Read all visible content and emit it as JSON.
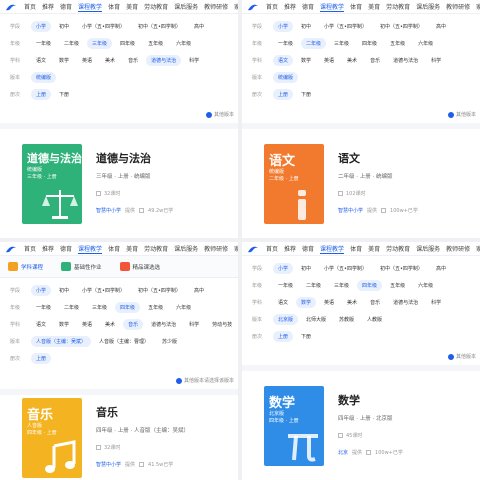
{
  "colors": {
    "accent": "#1e5ee8",
    "cover_green": "#2fb27a",
    "cover_orange": "#f27a2e",
    "cover_yellow": "#f4b320",
    "cover_blue": "#2f8de8"
  },
  "tl": {
    "nav": [
      "首页",
      "推荐",
      "德育",
      "课程教学",
      "体育",
      "美育",
      "劳动教育",
      "课后服务",
      "教师研修",
      "家"
    ],
    "nav_active": 3,
    "rows": [
      {
        "label": "学段",
        "opts": [
          "小学",
          "初中",
          "小学（五•四学制）",
          "初中（五•四学制）",
          "高中"
        ],
        "sel": 0
      },
      {
        "label": "年级",
        "opts": [
          "一年级",
          "二年级",
          "三年级",
          "四年级",
          "五年级",
          "六年级"
        ],
        "sel": 2
      },
      {
        "label": "学科",
        "opts": [
          "语文",
          "数学",
          "英语",
          "美术",
          "音乐",
          "道德与法治",
          "科学"
        ],
        "sel": 5
      },
      {
        "label": "版本",
        "opts": [
          "统编版"
        ],
        "sel": 0
      },
      {
        "label": "册次",
        "opts": [
          "上册",
          "下册"
        ],
        "sel": 0
      }
    ],
    "dict": "其他版本",
    "card": {
      "cover_title": "道德与法治",
      "cover_sub1": "统编版",
      "cover_sub2": "三年级 · 上册",
      "title": "道德与法治",
      "sub": "三年级 · 上册 · 统编版",
      "hours": "32课时",
      "provider": "智慧中小学",
      "provider_suffix": "提供",
      "views": "49.2w已学"
    }
  },
  "tr": {
    "nav": [
      "首页",
      "推荐",
      "德育",
      "课程教学",
      "体育",
      "美育",
      "劳动教育",
      "课后服务",
      "教师研修",
      "家"
    ],
    "nav_active": 3,
    "rows": [
      {
        "label": "学段",
        "opts": [
          "小学",
          "初中",
          "小学（五•四学制）",
          "初中（五•四学制）",
          "高中"
        ],
        "sel": 0
      },
      {
        "label": "年级",
        "opts": [
          "一年级",
          "二年级",
          "三年级",
          "四年级",
          "五年级",
          "六年级"
        ],
        "sel": 1
      },
      {
        "label": "学科",
        "opts": [
          "语文",
          "数学",
          "英语",
          "美术",
          "音乐",
          "道德与法治",
          "科学"
        ],
        "sel": 0
      },
      {
        "label": "版本",
        "opts": [
          "统编版"
        ],
        "sel": 0
      },
      {
        "label": "册次",
        "opts": [
          "上册",
          "下册"
        ],
        "sel": 0
      }
    ],
    "dict": "其他版本",
    "card": {
      "cover_title": "语文",
      "cover_sub1": "统编版",
      "cover_sub2": "二年级 · 上册",
      "title": "语文",
      "sub": "二年级 · 上册 · 统编版",
      "hours": "102课时",
      "provider": "智慧中小学",
      "provider_suffix": "提供",
      "views": "100w+已学"
    }
  },
  "bl": {
    "nav": [
      "首页",
      "推荐",
      "德育",
      "课程教学",
      "体育",
      "美育",
      "劳动教育",
      "课后服务",
      "教师研修",
      "家庭教育",
      "教"
    ],
    "nav_active": 3,
    "tabs": [
      "学科课程",
      "基础性作业",
      "精品课选选"
    ],
    "rows": [
      {
        "label": "学段",
        "opts": [
          "小学",
          "初中",
          "小学（五•四学制）",
          "初中（五•四学制）",
          "高中"
        ],
        "sel": 0
      },
      {
        "label": "年级",
        "opts": [
          "一年级",
          "二年级",
          "三年级",
          "四年级",
          "五年级",
          "六年级"
        ],
        "sel": 3
      },
      {
        "label": "学科",
        "opts": [
          "语文",
          "数学",
          "英语",
          "美术",
          "音乐",
          "道德与法治",
          "科学",
          "劳动与技术"
        ],
        "sel": 4
      },
      {
        "label": "版本",
        "opts": [
          "人音版（主编：吴斌）",
          "人音版（主编：曹理）",
          "苏少版"
        ],
        "sel": 0
      },
      {
        "label": "册次",
        "opts": [
          "上册"
        ],
        "sel": 0
      }
    ],
    "dict": "其他版本请选择该版本",
    "card": {
      "cover_title": "音乐",
      "cover_sub1": "人音版",
      "cover_sub2": "四年级 · 上册",
      "title": "音乐",
      "sub": "四年级 · 上册 · 人音版（主编：吴斌）",
      "hours": "32课时",
      "provider": "智慧中小学",
      "provider_suffix": "提供",
      "views": "41.5w已学"
    }
  },
  "br": {
    "nav": [
      "首页",
      "推荐",
      "德育",
      "课程教学",
      "体育",
      "美育",
      "劳动教育",
      "课后服务",
      "教师研修",
      "家"
    ],
    "nav_active": 3,
    "rows": [
      {
        "label": "学段",
        "opts": [
          "小学",
          "初中",
          "小学（五•四学制）",
          "初中（五•四学制）",
          "高中"
        ],
        "sel": 0
      },
      {
        "label": "年级",
        "opts": [
          "一年级",
          "二年级",
          "三年级",
          "四年级",
          "五年级",
          "六年级"
        ],
        "sel": 3
      },
      {
        "label": "学科",
        "opts": [
          "语文",
          "数学",
          "英语",
          "美术",
          "音乐",
          "道德与法治",
          "科学"
        ],
        "sel": 1
      },
      {
        "label": "版本",
        "opts": [
          "北京版",
          "北师大版",
          "苏教版",
          "人教版"
        ],
        "sel": 0
      },
      {
        "label": "册次",
        "opts": [
          "上册",
          "下册"
        ],
        "sel": 0
      }
    ],
    "dict": "其他版本",
    "card": {
      "cover_title": "数学",
      "cover_sub1": "北京版",
      "cover_sub2": "四年级 · 上册",
      "title": "数学",
      "sub": "四年级 · 上册 · 北京版",
      "hours": "45课时",
      "provider": "北京",
      "provider_suffix": "提供",
      "views": "100w+已学"
    }
  }
}
